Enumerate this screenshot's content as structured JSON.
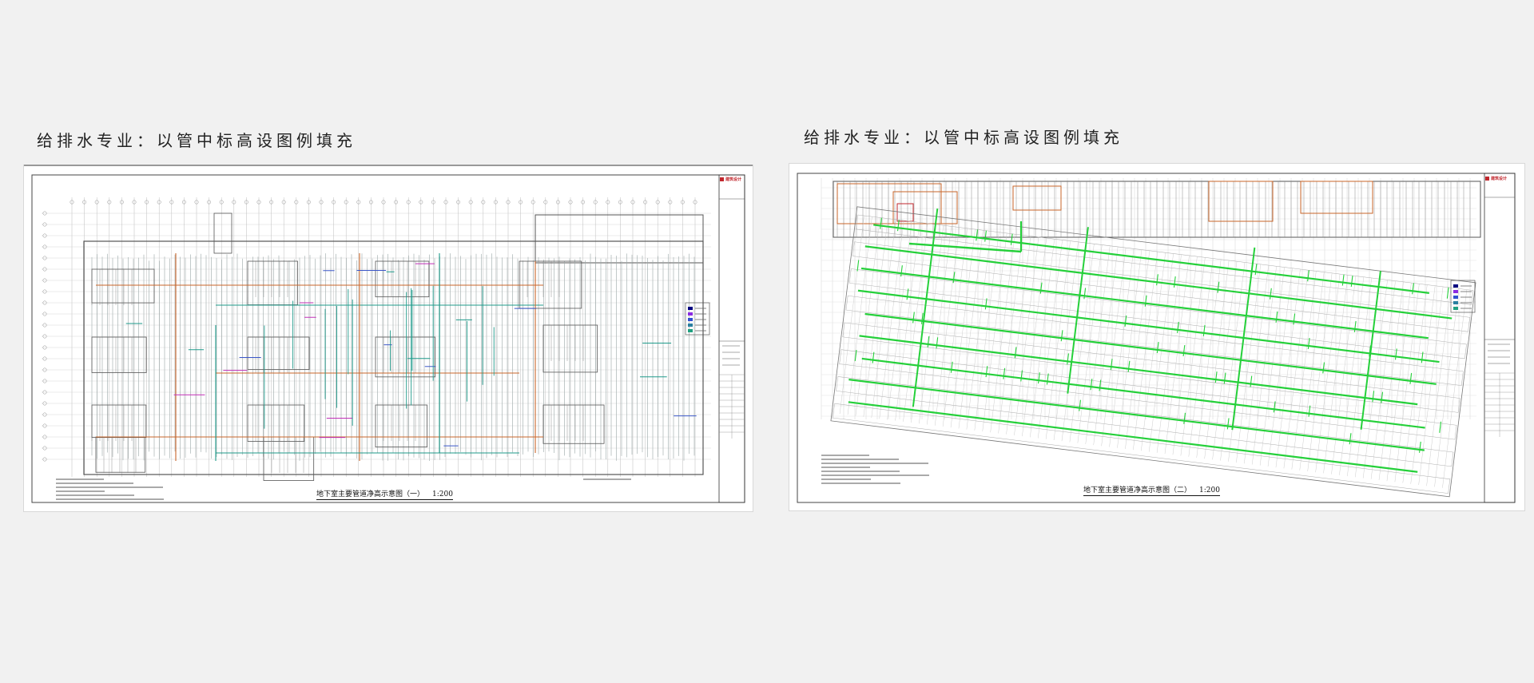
{
  "panels": [
    {
      "caption": "给排水专业：以管中标高设图例填充",
      "drawing_title": "地下室主要管道净高示意图（一）",
      "scale": "1:200",
      "stamp": "建筑设计"
    },
    {
      "caption": "给排水专业：以管中标高设图例填充",
      "drawing_title": "地下室主要管道净高示意图（二）",
      "scale": "1:200",
      "stamp": "建筑设计"
    }
  ],
  "colors": {
    "page_background": "#f1f1f1",
    "sheet": "#ffffff",
    "linework": "#8c8c8c",
    "wall": "#555555",
    "pipe_orange": "#c8662a",
    "pipe_teal": "#1e9a8a",
    "pipe_blue": "#3a56c8",
    "pipe_magenta": "#c02fb6",
    "pipe_green": "#25d03a",
    "legend": [
      "#000080",
      "#8a2be2",
      "#3050d0",
      "#2a7fa0",
      "#20a080"
    ],
    "stamp_red": "#c1272d"
  },
  "icons": [
    "title-block",
    "legend-swatches",
    "stamp-logo"
  ]
}
